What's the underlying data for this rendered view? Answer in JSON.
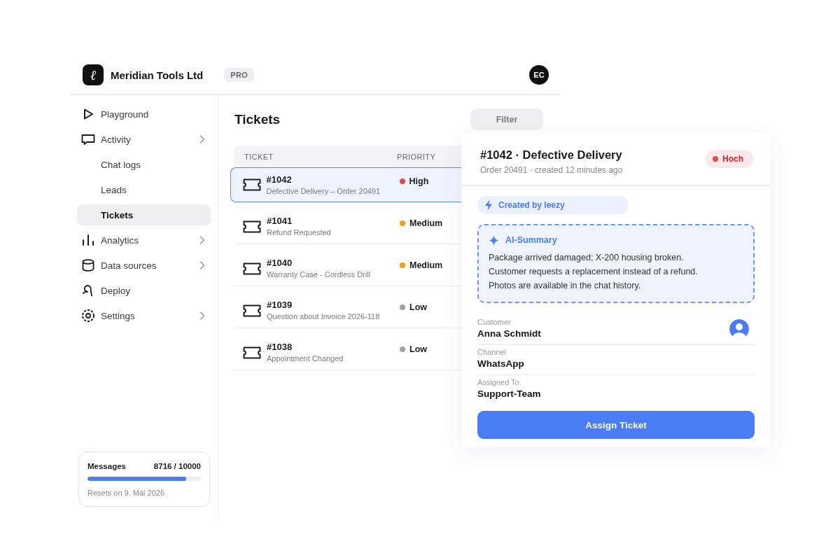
{
  "header": {
    "logo_mark": "ℓ",
    "company": "Meridian Tools Ltd",
    "plan_badge": "PRO",
    "user_initials": "EC"
  },
  "sidebar": {
    "items": [
      {
        "label": "Playground",
        "selected": false,
        "expandable": false
      },
      {
        "label": "Activity",
        "selected": false,
        "expandable": true,
        "children": [
          {
            "label": "Chat logs",
            "selected": false
          },
          {
            "label": "Leads",
            "selected": false
          },
          {
            "label": "Tickets",
            "selected": true
          }
        ]
      },
      {
        "label": "Analytics",
        "selected": false,
        "expandable": true
      },
      {
        "label": "Data sources",
        "selected": false,
        "expandable": true
      },
      {
        "label": "Deploy",
        "selected": false,
        "expandable": false
      },
      {
        "label": "Settings",
        "selected": false,
        "expandable": true
      }
    ],
    "usage": {
      "label": "Messages",
      "count": "8716 / 10000",
      "level": 0.8716,
      "note": "Resets on 9. Mai 2026"
    }
  },
  "main": {
    "title": "Tickets",
    "filter_button": "Filter",
    "table": {
      "columns": [
        "TICKET",
        "PRIORITY"
      ],
      "rows": [
        {
          "id": "#1042",
          "subject": "Defective Delivery – Order 20491",
          "priority": "High",
          "color": "#e5484d",
          "selected": true
        },
        {
          "id": "#1041",
          "subject": "Refund Requested",
          "priority": "Medium",
          "color": "#f59e0b",
          "selected": false
        },
        {
          "id": "#1040",
          "subject": "Warranty Case - Cordless Drill",
          "priority": "Medium",
          "color": "#f59e0b",
          "selected": false
        },
        {
          "id": "#1039",
          "subject": "Question about Invoice 2026-118",
          "priority": "Low",
          "color": "#a1a1a8",
          "selected": false
        },
        {
          "id": "#1038",
          "subject": "Appointment Changed",
          "priority": "Low",
          "color": "#a1a1a8",
          "selected": false
        }
      ]
    }
  },
  "detail": {
    "title": "#1042 · Defective Delivery",
    "meta": "Order 20491 · created 12 minutes ago",
    "priority_badge": "Hoch",
    "origin_chip": "Created by leezy",
    "summary": {
      "title": "AI-Summary",
      "lines": [
        "Package arrived damaged; X-200 housing broken.",
        "Customer requests a replacement instead of a refund.",
        "Photos are available in the chat history."
      ]
    },
    "fields": [
      {
        "label": "Customer",
        "value": "Anna Schmidt"
      },
      {
        "label": "Channel",
        "value": "WhatsApp"
      },
      {
        "label": "Assigned To",
        "value": "Support-Team"
      }
    ],
    "action_button": "Assign Ticket"
  }
}
